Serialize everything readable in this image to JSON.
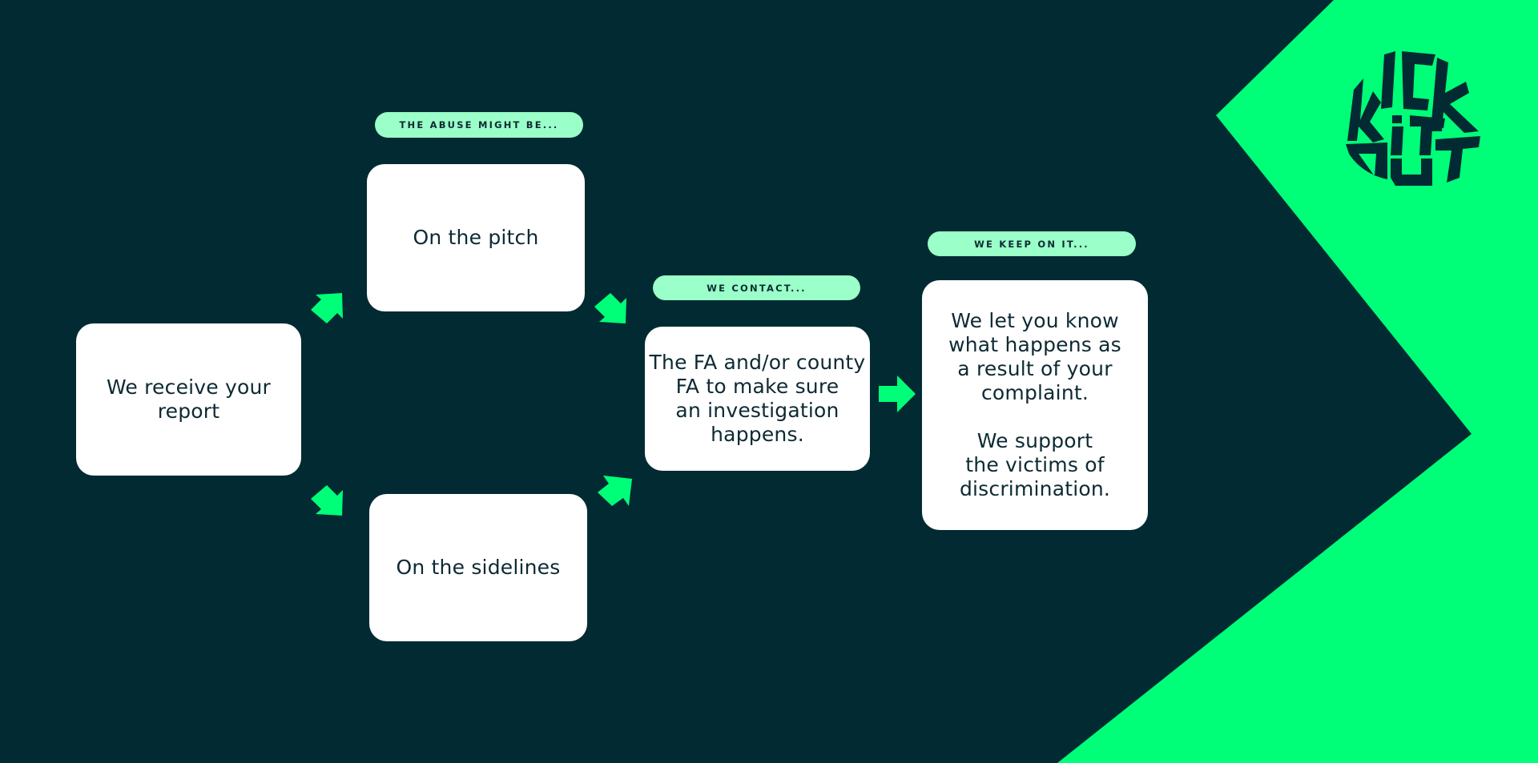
{
  "colors": {
    "background": "#022a33",
    "accent_green": "#00ff78",
    "pill_fill": "#9affc8",
    "box_fill": "#ffffff",
    "text_dark": "#0d2a33"
  },
  "logo": {
    "text_lines": [
      "KICK",
      "iT",
      "OUT"
    ],
    "icon": "kick-it-out-logo"
  },
  "flow": {
    "start": {
      "text": "We receive your\nreport"
    },
    "stage_abuse": {
      "pill": "THE ABUSE MIGHT BE...",
      "options": [
        {
          "text": "On the pitch"
        },
        {
          "text": "On the sidelines"
        }
      ]
    },
    "stage_contact": {
      "pill": "WE CONTACT...",
      "text": "The FA and/or county\nFA to make sure\nan investigation\nhappens."
    },
    "stage_follow_up": {
      "pill": "WE KEEP ON IT...",
      "text": "We let you know\nwhat happens as\na result of your\ncomplaint.\n\nWe support\nthe victims of\ndiscrimination."
    },
    "arrows": [
      {
        "from": "start",
        "to": "On the pitch",
        "direction": "up-right"
      },
      {
        "from": "start",
        "to": "On the sidelines",
        "direction": "down-right"
      },
      {
        "from": "On the pitch",
        "to": "stage_contact",
        "direction": "down-right"
      },
      {
        "from": "On the sidelines",
        "to": "stage_contact",
        "direction": "up-right"
      },
      {
        "from": "stage_contact",
        "to": "stage_follow_up",
        "direction": "right"
      }
    ]
  }
}
